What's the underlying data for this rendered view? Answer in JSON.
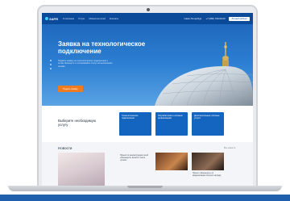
{
  "header": {
    "logo": "ЗАРЯ",
    "nav": [
      "О компании",
      "Услуги",
      "Абонентам сетей",
      "Контакты"
    ],
    "city": "Санкт-Петербург",
    "phone": "+7 (800) 700-00-00",
    "cta": "Личный кабинет"
  },
  "hero": {
    "title": "Заявка на технологическое подключение",
    "subtitle": "Подайте заявку на технологическое подключение к сетям Ленэнерго и отслеживайте статус её выполнения онлайн",
    "button": "Подать заявку"
  },
  "services": {
    "title": "Выберите необходимую услугу",
    "cards": [
      "Технологическое подключение",
      "Потребителям и сетевым организациям",
      "Дополнительные платные услуги"
    ]
  },
  "news": {
    "title": "Новости",
    "all_link": "Все новости",
    "items": [
      "Проект по реконструкции сетей «Ленэнерго» вошёл в число лучших",
      "Проект «Ленэнерго» по модернизации получил награду"
    ]
  },
  "colors": {
    "primary": "#1465c0",
    "accent": "#f07b1f",
    "header": "#0a4696"
  }
}
